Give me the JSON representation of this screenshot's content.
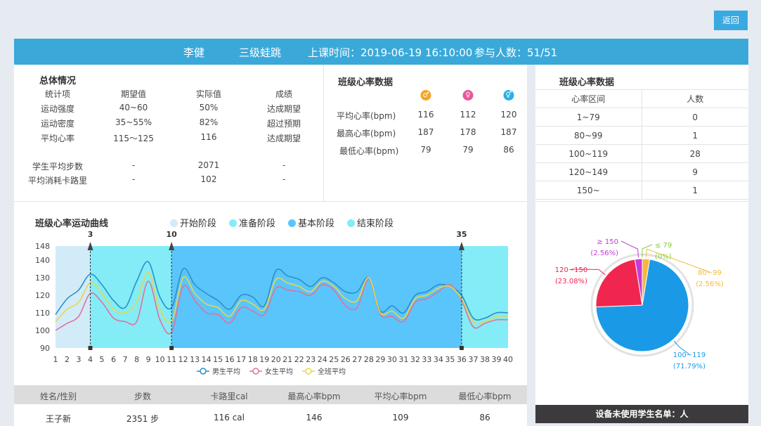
{
  "back_label": "返回",
  "header": {
    "teacher": "李健",
    "course": "三级蛙跳",
    "time": "上课时间：2019-06-19 16:10:00",
    "participants": "参与人数：51/51"
  },
  "overall": {
    "title": "总体情况",
    "columns": [
      "统计项",
      "期望值",
      "实际值",
      "成绩"
    ],
    "rows": [
      [
        "运动强度",
        "40~60",
        "50%",
        "达成期望"
      ],
      [
        "运动密度",
        "35~55%",
        "82%",
        "超过预期"
      ],
      [
        "平均心率",
        "115～125",
        "116",
        "达成期望"
      ]
    ],
    "rows2": [
      [
        "学生平均步数",
        "-",
        "2071",
        "-"
      ],
      [
        "平均消耗卡路里",
        "-",
        "102",
        "-"
      ]
    ]
  },
  "hr": {
    "title": "班级心率数据",
    "icons": [
      {
        "name": "male-icon",
        "color": "#f5a623",
        "glyph": "♂"
      },
      {
        "name": "female-icon",
        "color": "#e9579a",
        "glyph": "♀"
      },
      {
        "name": "all-icon",
        "color": "#2ab0e8",
        "glyph": "⚥"
      }
    ],
    "rows": [
      [
        "平均心率(bpm)",
        "116",
        "112",
        "120"
      ],
      [
        "最高心率(bpm)",
        "187",
        "178",
        "187"
      ],
      [
        "最低心率(bpm)",
        "79",
        "79",
        "86"
      ]
    ]
  },
  "range": {
    "title": "班级心率数据",
    "columns": [
      "心率区间",
      "人数"
    ],
    "rows": [
      [
        "1~79",
        "0"
      ],
      [
        "80~99",
        "1"
      ],
      [
        "100~119",
        "28"
      ],
      [
        "120~149",
        "9"
      ],
      [
        "150~",
        "1"
      ]
    ]
  },
  "curve": {
    "title": "班级心率运动曲线",
    "stages": [
      {
        "label": "开始阶段",
        "color": "#d2ebf8"
      },
      {
        "label": "准备阶段",
        "color": "#84ecf7"
      },
      {
        "label": "基本阶段",
        "color": "#5ac5fb"
      },
      {
        "label": "结束阶段",
        "color": "#84ecf7"
      }
    ]
  },
  "chart_data": {
    "type": "line",
    "x": [
      1,
      2,
      3,
      4,
      5,
      6,
      7,
      8,
      9,
      10,
      11,
      12,
      13,
      14,
      15,
      16,
      17,
      18,
      19,
      20,
      21,
      22,
      23,
      24,
      25,
      26,
      27,
      28,
      29,
      30,
      31,
      32,
      33,
      34,
      35,
      36,
      37,
      38,
      39,
      40
    ],
    "ylim": [
      90,
      148
    ],
    "yticks": [
      90,
      100,
      110,
      120,
      130,
      140,
      148
    ],
    "stage_bounds": [
      1,
      4,
      11,
      36,
      40
    ],
    "markers": [
      {
        "x": 4,
        "label": "3"
      },
      {
        "x": 11,
        "label": "10"
      },
      {
        "x": 36,
        "label": "35"
      }
    ],
    "series": [
      {
        "name": "男生平均",
        "color": "#2891c8",
        "values": [
          109,
          118,
          123,
          132,
          126,
          117,
          113,
          128,
          139,
          119,
          113,
          135,
          126,
          121,
          117,
          112,
          120,
          119,
          114,
          134,
          131,
          129,
          125,
          130,
          127,
          122,
          122,
          130,
          111,
          114,
          110,
          120,
          122,
          126,
          125,
          120,
          107,
          107,
          110,
          110
        ]
      },
      {
        "name": "女生平均",
        "color": "#e0719c",
        "values": [
          100,
          104,
          108,
          121,
          116,
          107,
          105,
          105,
          128,
          106,
          99,
          125,
          117,
          110,
          109,
          104,
          113,
          111,
          109,
          124,
          123,
          122,
          120,
          126,
          123,
          114,
          113,
          129,
          109,
          108,
          105,
          116,
          118,
          122,
          126,
          117,
          102,
          104,
          106,
          106
        ]
      },
      {
        "name": "全班平均",
        "color": "#e5d84b",
        "values": [
          105,
          112,
          116,
          127,
          121,
          112,
          110,
          116,
          133,
          112,
          105,
          130,
          121,
          115,
          113,
          108,
          117,
          115,
          112,
          129,
          127,
          125,
          122,
          128,
          125,
          118,
          117,
          130,
          110,
          111,
          107,
          118,
          120,
          124,
          125,
          118,
          105,
          105,
          108,
          108
        ]
      }
    ]
  },
  "pie": {
    "slices": [
      {
        "label": "100~119",
        "pct": "(71.79%)",
        "value": 71.79,
        "color": "#1a9ae6"
      },
      {
        "label": "120~150",
        "pct": "(23.08%)",
        "value": 23.08,
        "color": "#f0264e"
      },
      {
        "label": "≥ 150",
        "pct": "(2.56%)",
        "value": 2.56,
        "color": "#c53bd9"
      },
      {
        "label": "≤ 79",
        "pct": "(0%)",
        "value": 0.0,
        "color": "#7fcf3d"
      },
      {
        "label": "80~99",
        "pct": "(2.56%)",
        "value": 2.56,
        "color": "#f6b73c"
      }
    ]
  },
  "students": {
    "columns": [
      "姓名/性别",
      "步数",
      "卡路里cal",
      "最高心率bpm",
      "平均心率bpm",
      "最低心率bpm"
    ],
    "rows": [
      [
        "王子新",
        "2351 步",
        "116 cal",
        "146",
        "109",
        "86"
      ]
    ]
  },
  "unused_label": "设备未使用学生名单：人"
}
